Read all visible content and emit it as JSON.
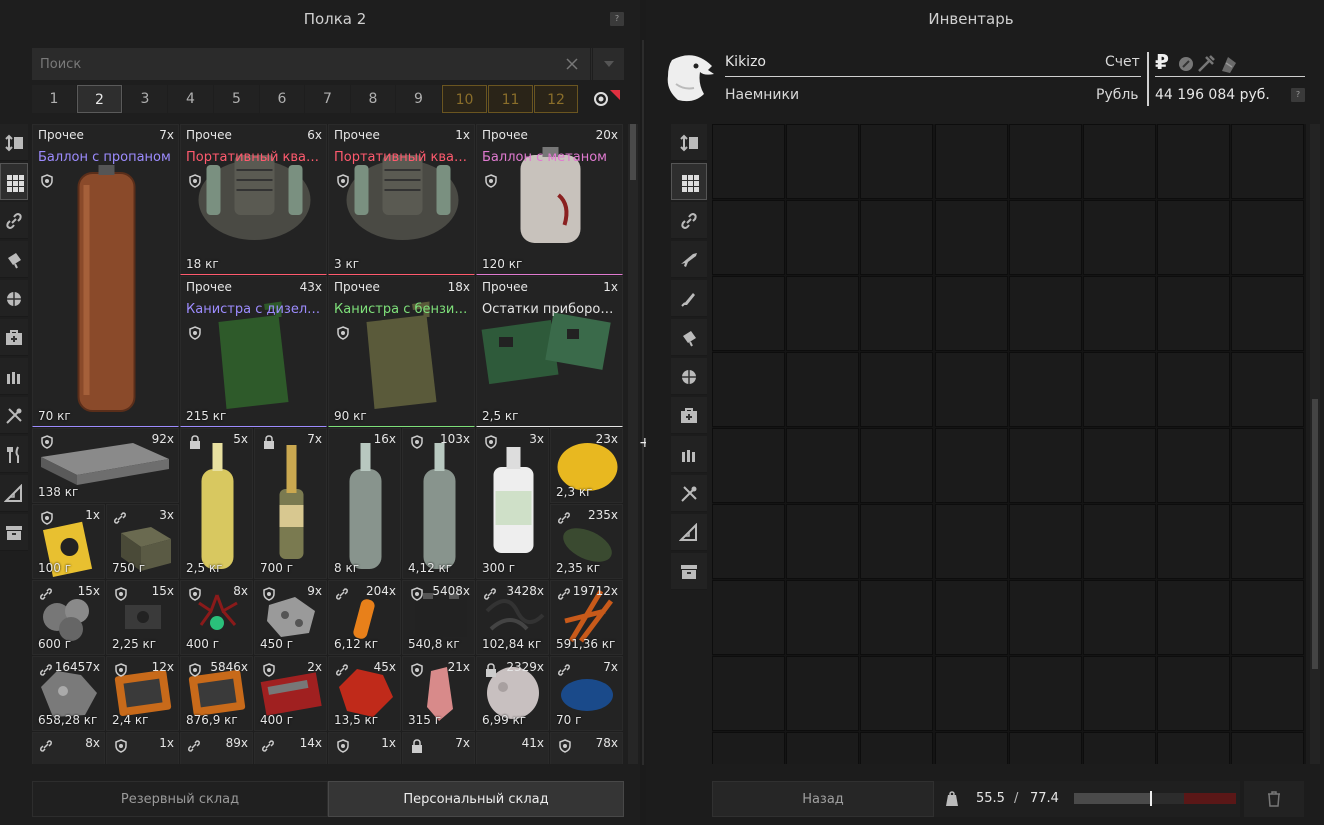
{
  "stash": {
    "title": "Полка 2",
    "help": "?",
    "search_placeholder": "Поиск",
    "tabs": [
      {
        "label": "1",
        "state": "normal"
      },
      {
        "label": "2",
        "state": "active"
      },
      {
        "label": "3",
        "state": "normal"
      },
      {
        "label": "4",
        "state": "normal"
      },
      {
        "label": "5",
        "state": "normal"
      },
      {
        "label": "6",
        "state": "normal"
      },
      {
        "label": "7",
        "state": "normal"
      },
      {
        "label": "8",
        "state": "normal"
      },
      {
        "label": "9",
        "state": "normal"
      },
      {
        "label": "10",
        "state": "locked"
      },
      {
        "label": "11",
        "state": "locked"
      },
      {
        "label": "12",
        "state": "locked"
      }
    ],
    "sidebar_icons": [
      "sort-icon",
      "grid-icon",
      "link-icon",
      "flashlight-icon",
      "ball-icon",
      "medkit-icon",
      "ammo-icon",
      "tools-icon",
      "fork-knife-icon",
      "ruler-icon",
      "archive-icon"
    ],
    "items": [
      {
        "cat": "Прочее",
        "count": "7x",
        "name": "Баллон с пропаном",
        "name_color": "#9d8cff",
        "weight": "70 кг",
        "shield": true,
        "art": "propane"
      },
      {
        "cat": "Прочее",
        "count": "6x",
        "name": "Портативный квантовы...",
        "name_color": "#ff5a6e",
        "weight": "18 кг",
        "shield": true,
        "art": "quantum"
      },
      {
        "cat": "Прочее",
        "count": "1x",
        "name": "Портативный квантовы...",
        "name_color": "#ff5a6e",
        "weight": "3 кг",
        "shield": true,
        "art": "quantum"
      },
      {
        "cat": "Прочее",
        "count": "20x",
        "name": "Баллон с метаном",
        "name_color": "#e07ad0",
        "weight": "120 кг",
        "shield": true,
        "art": "methane"
      },
      {
        "cat": "Прочее",
        "count": "43x",
        "name": "Канистра с дизелем",
        "name_color": "#9d8cff",
        "weight": "215 кг",
        "shield": true,
        "art": "jerry-green"
      },
      {
        "cat": "Прочее",
        "count": "18x",
        "name": "Канистра с бензином",
        "name_color": "#7ee07a",
        "weight": "90 кг",
        "shield": true,
        "art": "jerry-olive"
      },
      {
        "cat": "Прочее",
        "count": "1x",
        "name": "Остатки приборов «Ше...",
        "name_color": "#e6e6e6",
        "weight": "2,5 кг",
        "shield": false,
        "art": "pcb"
      },
      {
        "cat": "",
        "count": "92x",
        "name": "",
        "name_color": "",
        "weight": "138 кг",
        "shield": true,
        "art": "crate"
      },
      {
        "cat": "",
        "count": "5x",
        "name": "",
        "name_color": "",
        "weight": "2,5 кг",
        "lock": true,
        "art": "bottle-yellow"
      },
      {
        "cat": "",
        "count": "7x",
        "name": "",
        "name_color": "",
        "weight": "700 г",
        "lock": true,
        "art": "champagne"
      },
      {
        "cat": "",
        "count": "16x",
        "name": "",
        "name_color": "",
        "weight": "8 кг",
        "art": "bottle-clear"
      },
      {
        "cat": "",
        "count": "103x",
        "name": "",
        "name_color": "",
        "weight": "4,12 кг",
        "shield": true,
        "art": "bottle-clear"
      },
      {
        "cat": "",
        "count": "3x",
        "name": "",
        "name_color": "",
        "weight": "300 г",
        "shield": true,
        "art": "bottle-white"
      },
      {
        "cat": "",
        "count": "23x",
        "name": "",
        "name_color": "",
        "weight": "2,3 кг",
        "art": "lemon"
      },
      {
        "cat": "",
        "count": "1x",
        "name": "",
        "name_color": "",
        "weight": "100 г",
        "shield": true,
        "art": "book"
      },
      {
        "cat": "",
        "count": "3x",
        "name": "",
        "name_color": "",
        "weight": "750 г",
        "link": true,
        "art": "box"
      },
      {
        "cat": "",
        "count": "235x",
        "name": "",
        "name_color": "",
        "weight": "2,35 кг",
        "link": true,
        "art": "leaf"
      },
      {
        "cat": "",
        "count": "15x",
        "name": "",
        "name_color": "",
        "weight": "600 г",
        "link": true,
        "art": "grey-blob"
      },
      {
        "cat": "",
        "count": "15x",
        "name": "",
        "name_color": "",
        "weight": "2,25 кг",
        "shield": true,
        "art": "device"
      },
      {
        "cat": "",
        "count": "8x",
        "name": "",
        "name_color": "",
        "weight": "400 г",
        "shield": true,
        "art": "red-spider"
      },
      {
        "cat": "",
        "count": "9x",
        "name": "",
        "name_color": "",
        "weight": "450 г",
        "shield": true,
        "art": "metal"
      },
      {
        "cat": "",
        "count": "204x",
        "name": "",
        "name_color": "",
        "weight": "6,12 кг",
        "link": true,
        "art": "vial"
      },
      {
        "cat": "",
        "count": "5408x",
        "name": "",
        "name_color": "",
        "weight": "540,8 кг",
        "shield": true,
        "art": "battery"
      },
      {
        "cat": "",
        "count": "3428x",
        "name": "",
        "name_color": "",
        "weight": "102,84 кг",
        "link": true,
        "art": "cables"
      },
      {
        "cat": "",
        "count": "19712x",
        "name": "",
        "name_color": "",
        "weight": "591,36 кг",
        "link": true,
        "art": "orange-fern"
      },
      {
        "cat": "",
        "count": "16457x",
        "name": "",
        "name_color": "",
        "weight": "658,28 кг",
        "link": true,
        "art": "ore"
      },
      {
        "cat": "",
        "count": "12x",
        "name": "",
        "name_color": "",
        "weight": "2,4 кг",
        "shield": true,
        "art": "panel-orange"
      },
      {
        "cat": "",
        "count": "5846x",
        "name": "",
        "name_color": "",
        "weight": "876,9 кг",
        "shield": true,
        "art": "panel-orange"
      },
      {
        "cat": "",
        "count": "2x",
        "name": "",
        "name_color": "",
        "weight": "400 г",
        "shield": true,
        "art": "panel-red"
      },
      {
        "cat": "",
        "count": "45x",
        "name": "",
        "name_color": "",
        "weight": "13,5 кг",
        "link": true,
        "art": "red-crystal"
      },
      {
        "cat": "",
        "count": "21x",
        "name": "",
        "name_color": "",
        "weight": "315 г",
        "shield": true,
        "art": "pink-crystal"
      },
      {
        "cat": "",
        "count": "2329x",
        "name": "",
        "name_color": "",
        "weight": "6,99 кг",
        "lock": true,
        "art": "moon"
      },
      {
        "cat": "",
        "count": "7x",
        "name": "",
        "name_color": "",
        "weight": "70 г",
        "link": true,
        "art": "blue-moss"
      },
      {
        "cat": "",
        "count": "8x",
        "name": "",
        "name_color": "",
        "weight": "",
        "link": true,
        "art": "dark"
      },
      {
        "cat": "",
        "count": "1x",
        "name": "",
        "name_color": "",
        "weight": "",
        "shield": true,
        "art": "dark"
      },
      {
        "cat": "",
        "count": "89x",
        "name": "",
        "name_color": "",
        "weight": "",
        "link": true,
        "art": "dark"
      },
      {
        "cat": "",
        "count": "14x",
        "name": "",
        "name_color": "",
        "weight": "",
        "link": true,
        "art": "dark"
      },
      {
        "cat": "",
        "count": "1x",
        "name": "",
        "name_color": "",
        "weight": "",
        "shield": true,
        "art": "dark"
      },
      {
        "cat": "",
        "count": "7x",
        "name": "",
        "name_color": "",
        "weight": "",
        "lock": true,
        "art": "dark"
      },
      {
        "cat": "",
        "count": "41x",
        "name": "",
        "name_color": "",
        "weight": "",
        "art": "dark"
      },
      {
        "cat": "",
        "count": "78x",
        "name": "",
        "name_color": "",
        "weight": "",
        "shield": true,
        "art": "dark"
      }
    ],
    "footer": {
      "reserve": "Резервный склад",
      "personal": "Персональный склад"
    }
  },
  "inventory": {
    "title": "Инвентарь",
    "help": "?",
    "name": "Kikizo",
    "faction": "Наемники",
    "account_label": "Счет",
    "currency_label": "Рубль",
    "balance": "44 196 084 руб.",
    "back_label": "Назад",
    "weight_current": "55.5",
    "weight_sep": "/",
    "weight_max": "77.4",
    "weight_fraction": 0.717,
    "sidebar_icons": [
      "sort-icon",
      "grid-icon",
      "link-icon",
      "rifle-icon",
      "knife-icon",
      "flashlight-icon",
      "ball-icon",
      "medkit-icon",
      "ammo-icon",
      "tools-icon",
      "ruler-icon",
      "archive-icon"
    ]
  },
  "colors": {
    "accent": "#d4a93a",
    "overweight": "#6b1a1a",
    "common": "#9d8cff",
    "rare": "#ff5a6e",
    "uncommon": "#7ee07a"
  }
}
